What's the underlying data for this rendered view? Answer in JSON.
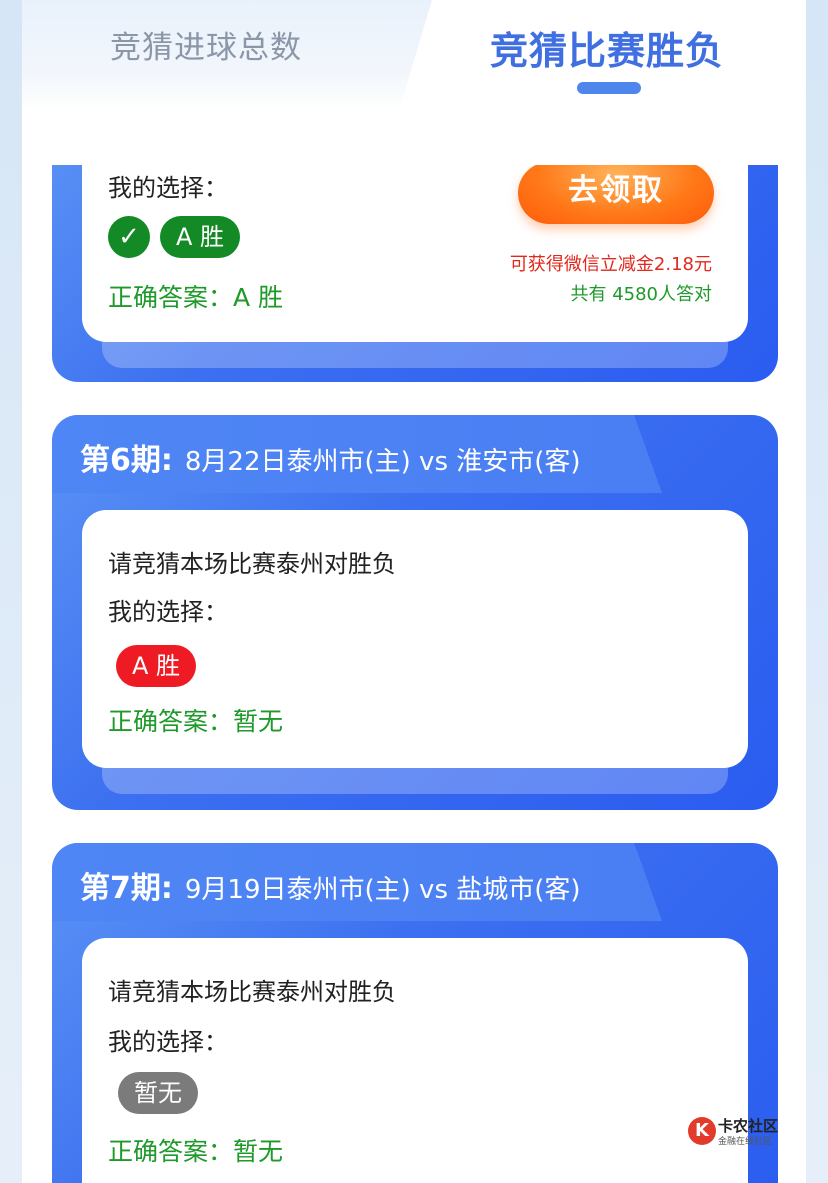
{
  "tabs": {
    "left": "竞猜进球总数",
    "right": "竞猜比赛胜负"
  },
  "card5": {
    "my_choice_label": "我的选择：",
    "choice_pill": "A 胜",
    "answer_text": "正确答案：A 胜",
    "claim_button": "去领取",
    "reward_text": "可获得微信立减金2.18元",
    "count_text": "共有 4580人答对"
  },
  "card6": {
    "period": "第6期:",
    "match": "8月22日泰州市(主) vs 淮安市(客)",
    "question": "请竞猜本场比赛泰州对胜负",
    "my_choice_label": "我的选择：",
    "choice_pill": "A 胜",
    "answer_text": "正确答案：暂无"
  },
  "card7": {
    "period": "第7期:",
    "match": "9月19日泰州市(主) vs 盐城市(客)",
    "question": "请竞猜本场比赛泰州对胜负",
    "my_choice_label": "我的选择：",
    "choice_pill": "暂无",
    "answer_text": "正确答案：暂无"
  },
  "watermark": {
    "logo": "K",
    "name": "卡农社区",
    "tagline": "金融在线社区"
  },
  "colors": {
    "accent": "#3f6fe0",
    "card_blue": "#3c70f0",
    "green": "#138a25",
    "red": "#ee1b24",
    "gray": "#7b7b7b",
    "orange": "#ff7a19"
  }
}
